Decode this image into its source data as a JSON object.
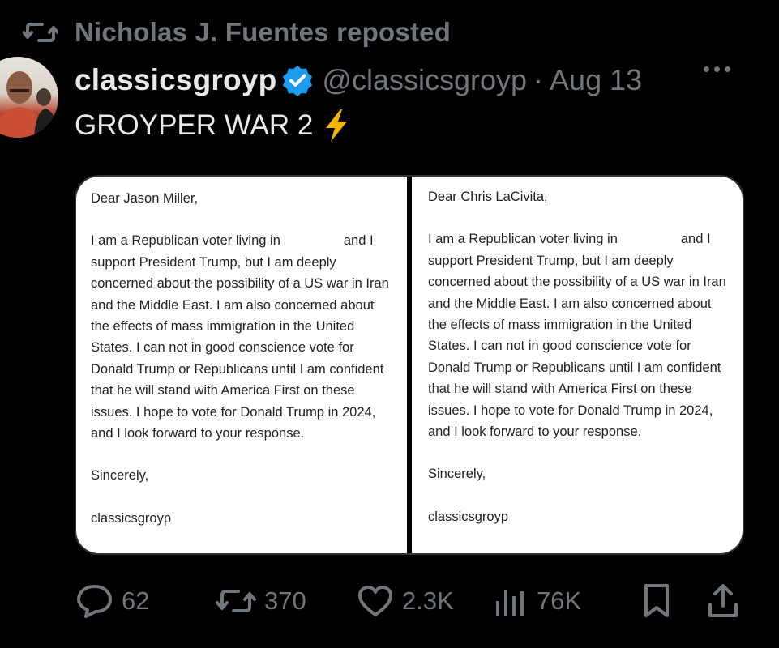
{
  "repost": {
    "text": "Nicholas J. Fuentes reposted"
  },
  "post": {
    "display_name": "classicsgroyp",
    "handle": "@classicsgroyp",
    "separator": "·",
    "date": "Aug 13",
    "text": "GROYPER WAR 2",
    "emoji": "⚡"
  },
  "letters": [
    {
      "salutation": "Dear Jason Miller,",
      "body": "I am a Republican voter living in",
      "body_after": "and I support President Trump, but I am deeply concerned about the possibility of a US war in Iran and the Middle East. I am also concerned about the effects of mass immigration in the United States. I can not in good conscience vote for Donald Trump or Republicans until I am confident that he will stand with America First on these issues. I hope to vote for Donald Trump in 2024, and I look forward to your response.",
      "closing": "Sincerely,",
      "signature": "classicsgroyp"
    },
    {
      "salutation": "Dear Chris LaCivita,",
      "body": "I am a Republican voter living in",
      "body_after": "and I support President Trump, but I am deeply concerned about the possibility of a US war in Iran and the Middle East. I am also concerned about the effects of mass immigration in the United States. I can not in good conscience vote for Donald Trump or Republicans until I am confident that he will stand with America First on these issues. I hope to vote for Donald Trump in 2024, and I look forward to your response.",
      "closing": "Sincerely,",
      "signature": "classicsgroyp"
    }
  ],
  "actions": {
    "replies": "62",
    "reposts": "370",
    "likes": "2.3K",
    "views": "76K"
  },
  "colors": {
    "background": "#000000",
    "text": "#e7e9ea",
    "muted": "#71767b",
    "verified": "#1d9bf0"
  },
  "icons": {
    "repost": "repost-icon",
    "verified": "verified-badge-icon",
    "more": "more-icon",
    "reply": "reply-icon",
    "like": "heart-icon",
    "views": "analytics-icon",
    "bookmark": "bookmark-icon",
    "share": "share-icon"
  }
}
